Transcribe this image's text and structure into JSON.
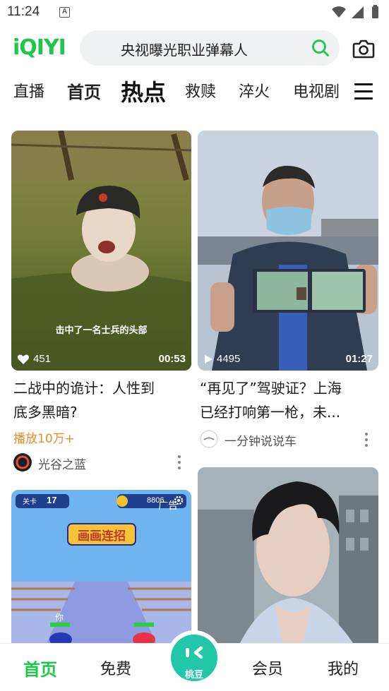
{
  "status_bar": {
    "time": "11:24",
    "notif": "A"
  },
  "header": {
    "logo": "iQIYI",
    "search_text": "央视曝光职业弹幕人"
  },
  "tabs": [
    {
      "label": "直播"
    },
    {
      "label": "首页"
    },
    {
      "label": "热点"
    },
    {
      "label": "救赎"
    },
    {
      "label": "淬火"
    },
    {
      "label": "电视剧"
    }
  ],
  "cards": [
    {
      "caption": "击中了一名士兵的头部",
      "likes": "451",
      "duration": "00:53",
      "title_line1": "二战中的诡计：人性到",
      "title_line2": "底多黑暗?",
      "plays": "播放10万+",
      "author": "光谷之蓝"
    },
    {
      "views": "4495",
      "duration": "01:27",
      "title_line1": "“再见了”驾驶证？上海",
      "title_line2": "已经打响第一枪，未...",
      "author": "一分钟说说车"
    },
    {
      "level_label": "关卡",
      "level": "17",
      "coins": "8806",
      "ad": "广告",
      "game_title": "画画连招",
      "you": "你"
    },
    {}
  ],
  "bottom_nav": {
    "home": "首页",
    "free": "免费",
    "center": "桃豆",
    "vip": "会员",
    "mine": "我的"
  },
  "colors": {
    "brand": "#1cc749",
    "plays": "#f08a24",
    "center": "#21c7a8"
  }
}
